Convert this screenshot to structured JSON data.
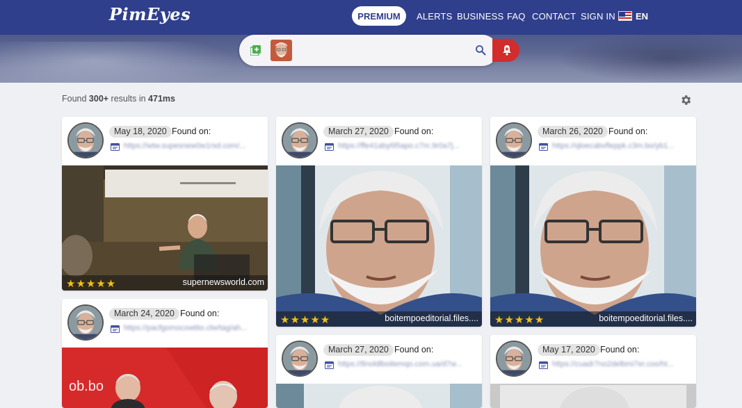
{
  "brand": {
    "logo_text": "PimEyes"
  },
  "nav": {
    "premium": "PREMIUM",
    "alerts": "ALERTS",
    "business": "BUSINESS",
    "faq": "FAQ",
    "contact": "CONTACT",
    "sign_in": "SIGN IN",
    "language": "EN"
  },
  "search": {
    "add_icon": "add-photo-icon",
    "search_icon": "search-icon",
    "alert_icon": "bell-icon"
  },
  "results": {
    "found_prefix": "Found ",
    "count": "300+",
    "middle": " results in ",
    "time": "471ms",
    "settings_icon": "gear-icon"
  },
  "found_on_label": "Found on:",
  "cards": [
    {
      "date": "May 18, 2020",
      "url": "https://wtw.supesnew0w1rsd.com/...",
      "rating": "★★★★★",
      "domain": "supernewsworld.com"
    },
    {
      "date": "March 27, 2020",
      "url": "https://ffe41abyl95apo.c7m.9r0a7j...",
      "rating": "★★★★★",
      "domain": "boitempoeditorial.files...."
    },
    {
      "date": "March 26, 2020",
      "url": "https://qloecabvfleppk.c3m.bo/yb1...",
      "rating": "★★★★★",
      "domain": "boitempoeditorial.files...."
    },
    {
      "date": "March 24, 2020",
      "url": "https://pacfgomocowtito.clw/tag/ah..."
    },
    {
      "date": "March 27, 2020",
      "url": "https://8noldlboitemqo.com.ua/d7w..."
    },
    {
      "date": "May 17, 2020",
      "url": "https://cuadr7no2delbmi7er.coo/ht..."
    }
  ],
  "colors": {
    "header": "#2f3f8c",
    "alert": "#d22c2c",
    "stars": "#f2c016"
  }
}
